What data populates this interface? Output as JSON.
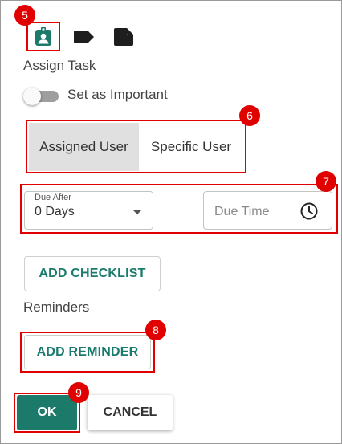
{
  "colors": {
    "accent": "#1c7a6a",
    "annotation": "#e00000",
    "segment_selected_bg": "#e0e0e0"
  },
  "tabs": [
    {
      "icon": "person-badge-icon",
      "selected": true
    },
    {
      "icon": "label-tag-icon",
      "selected": false
    },
    {
      "icon": "note-icon",
      "selected": false
    }
  ],
  "task": {
    "heading": "Assign Task",
    "important_toggle": {
      "label": "Set as Important",
      "on": false
    }
  },
  "assignee": {
    "options": [
      "Assigned User",
      "Specific User"
    ],
    "selected": "Assigned User"
  },
  "due": {
    "after_label": "Due After",
    "after_value": "0 Days",
    "time_placeholder": "Due Time"
  },
  "checklist": {
    "button_label": "ADD CHECKLIST"
  },
  "reminders": {
    "heading": "Reminders",
    "button_label": "ADD REMINDER"
  },
  "footer": {
    "ok_label": "OK",
    "cancel_label": "CANCEL"
  },
  "annotations": [
    "5",
    "6",
    "7",
    "8",
    "9"
  ]
}
